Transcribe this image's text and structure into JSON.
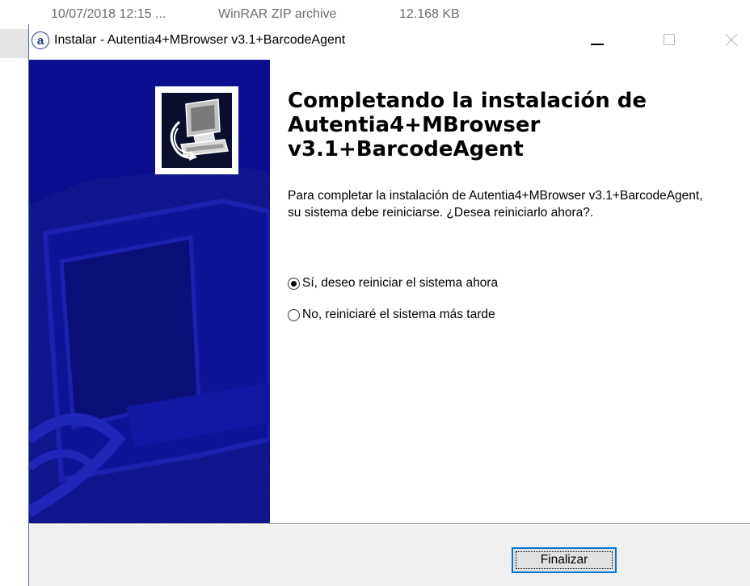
{
  "background": {
    "file_date": "10/07/2018 12:15 ...",
    "file_type": "WinRAR ZIP archive",
    "file_size": "12.168 KB"
  },
  "window": {
    "icon_letter": "a",
    "title": "Instalar - Autentia4+MBrowser v3.1+BarcodeAgent",
    "controls": [
      "minimize-icon",
      "maximize-icon",
      "close-icon"
    ]
  },
  "wizard": {
    "heading_lines": [
      "Completando la instalación de",
      "Autentia4+MBrowser",
      "v3.1+BarcodeAgent"
    ],
    "message": "Para completar la instalación de Autentia4+MBrowser v3.1+BarcodeAgent, su sistema debe reiniciarse. ¿Desea reiniciarlo ahora?.",
    "options": {
      "yes_label": "Sí, deseo reiniciar el sistema ahora",
      "no_label": "No, reiniciaré el sistema más tarde",
      "selected": "yes"
    },
    "side_icon": "computer-install-icon"
  },
  "footer": {
    "finish_label": "Finalizar"
  },
  "colors": {
    "side_bg": "#0b0f8f",
    "accent": "#0078d7"
  }
}
